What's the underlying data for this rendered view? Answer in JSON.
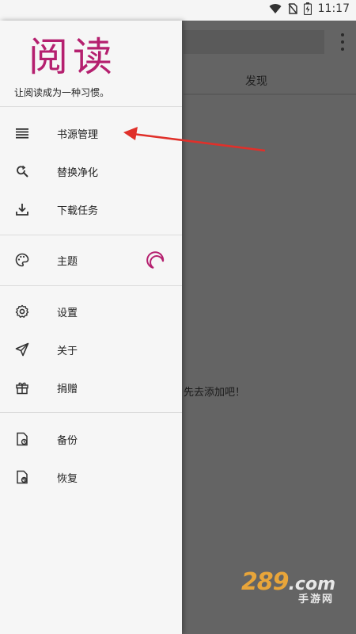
{
  "status_bar": {
    "time": "11:17"
  },
  "background": {
    "tab_label": "发现",
    "empty_hint": "先去添加吧！",
    "watermark_num": "289",
    "watermark_com": ".com",
    "watermark_sub": "手游网"
  },
  "drawer": {
    "logo_text": "阅读",
    "slogan": "让阅读成为一种习惯。",
    "groups": [
      [
        {
          "label": "书源管理",
          "icon": "menu-lines-icon"
        },
        {
          "label": "替换净化",
          "icon": "find-replace-icon"
        },
        {
          "label": "下载任务",
          "icon": "download-icon"
        }
      ],
      [
        {
          "label": "主题",
          "icon": "palette-icon"
        }
      ],
      [
        {
          "label": "设置",
          "icon": "gear-icon"
        },
        {
          "label": "关于",
          "icon": "send-icon"
        },
        {
          "label": "捐赠",
          "icon": "gift-icon"
        }
      ],
      [
        {
          "label": "备份",
          "icon": "backup-icon"
        },
        {
          "label": "恢复",
          "icon": "restore-icon"
        }
      ]
    ]
  },
  "colors": {
    "accent": "#b5206f",
    "arrow": "#e0302a",
    "scrim": "#646464"
  }
}
